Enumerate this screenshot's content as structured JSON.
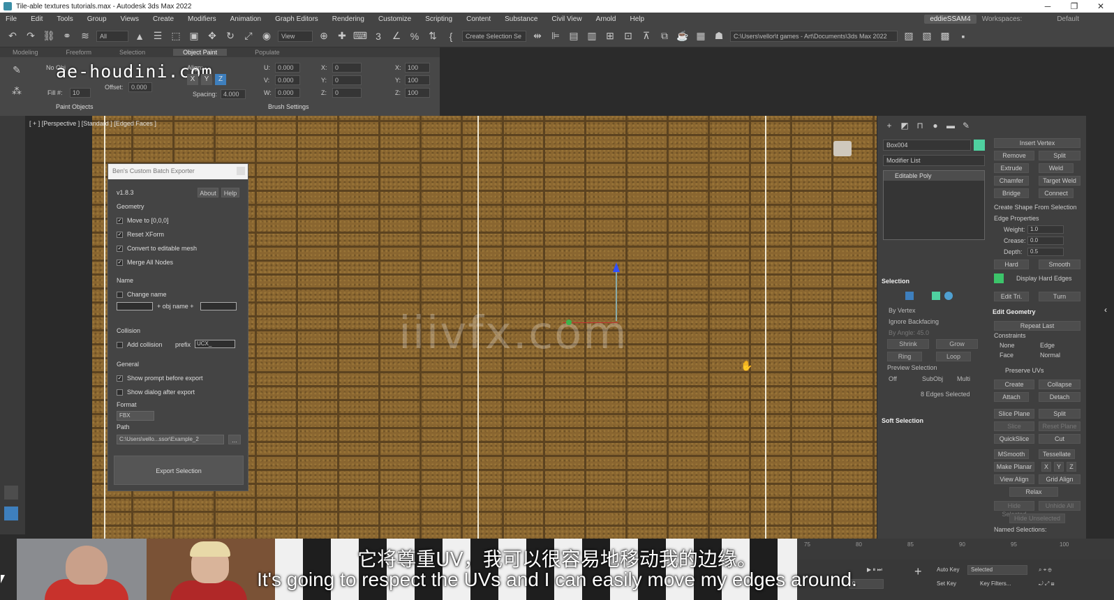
{
  "window": {
    "title": "Tile-able textures tutorials.max - Autodesk 3ds Max 2022",
    "controls": [
      "─",
      "❐",
      "✕"
    ]
  },
  "menubar": {
    "items": [
      "File",
      "Edit",
      "Tools",
      "Group",
      "Views",
      "Create",
      "Modifiers",
      "Animation",
      "Graph Editors",
      "Rendering",
      "Customize",
      "Scripting",
      "Content",
      "Substance",
      "Civil View",
      "Arnold",
      "Help"
    ],
    "user": "eddieSSAM4",
    "workspaces_label": "Workspaces:",
    "workspaces_value": "Default"
  },
  "toolbar": {
    "filter": "All",
    "view": "View",
    "selection_set": "Create Selection Se",
    "path": "C:\\Users\\vellor\\t games - Art\\Documents\\3ds Max 2022",
    "icons": [
      "undo-icon",
      "redo-icon",
      "link-icon",
      "unlink-icon",
      "bind-icon",
      "select-icon",
      "select-by-name-icon",
      "rect-select-icon",
      "window-crossing-icon",
      "move-icon",
      "rotate-icon",
      "scale-icon",
      "placement-icon"
    ]
  },
  "ribbon": {
    "tabs": [
      "Modeling",
      "Freeform",
      "Selection",
      "Object Paint",
      "Populate"
    ],
    "active_tab": "Object Paint",
    "no_object": "No Obj",
    "align_label": "Align:",
    "fill_label": "Fill #:",
    "fill_value": "10",
    "offset_label": "Offset:",
    "offset_value": "0.000",
    "spacing_label": "Spacing:",
    "spacing_value": "4.000",
    "u_value": "0.000",
    "v_value": "0.000",
    "w_value": "0.000",
    "x_value": "0",
    "y_value": "0",
    "z_value": "0",
    "scale_x": "100",
    "scale_y": "100",
    "scale_z": "100",
    "axes": [
      "X",
      "Y",
      "Z"
    ],
    "paint_objects": "Paint Objects",
    "brush_settings": "Brush Settings",
    "logo_watermark": "ae-houdini.com"
  },
  "viewport": {
    "label": "[ + ] [Perspective ] [Standard ] [Edged Faces ]",
    "watermark": "iiivfx.com"
  },
  "exporter": {
    "title": "Ben's Custom Batch Exporter",
    "version": "v1.8.3",
    "about": "About",
    "help": "Help",
    "geometry_label": "Geometry",
    "geometry_options": [
      {
        "label": "Move to [0,0,0]",
        "checked": true
      },
      {
        "label": "Reset XForm",
        "checked": true
      },
      {
        "label": "Convert to editable mesh",
        "checked": true
      },
      {
        "label": "Merge All Nodes",
        "checked": true
      }
    ],
    "name_label": "Name",
    "change_name": "Change name",
    "obj_name_text": "+ obj name +",
    "collision_label": "Collision",
    "add_collision": "Add collision",
    "prefix_label": "prefix",
    "prefix_value": "UCX_",
    "general_label": "General",
    "show_prompt": "Show prompt before export",
    "show_dialog": "Show dialog after export",
    "format_label": "Format",
    "format_value": "FBX",
    "path_label": "Path",
    "path_value": "C:\\Users\\vello...ssor\\Example_2",
    "browse": "...",
    "export_button": "Export Selection"
  },
  "command_panel": {
    "object_name": "Box004",
    "object_color": "#4fd1a0",
    "modifier_list": "Modifier List",
    "stack_item": "Editable Poly",
    "selection_head": "Selection",
    "by_vertex": "By Vertex",
    "ignore_backfacing": "Ignore Backfacing",
    "by_angle": "By Angle: 45.0",
    "shrink": "Shrink",
    "grow": "Grow",
    "ring": "Ring",
    "loop": "Loop",
    "preview_selection": "Preview Selection",
    "preview_off": "Off",
    "preview_subobj": "SubObj",
    "preview_multi": "Multi",
    "edges_selected": "8 Edges Selected",
    "soft_selection": "Soft Selection"
  },
  "edit_panel": {
    "insert_vertex": "Insert Vertex",
    "remove": "Remove",
    "split": "Split",
    "extrude": "Extrude",
    "weld": "Weld",
    "chamfer": "Chamfer",
    "target_weld": "Target Weld",
    "bridge": "Bridge",
    "connect": "Connect",
    "create_shape": "Create Shape From Selection",
    "edge_properties": "Edge Properties",
    "weight_label": "Weight:",
    "weight_value": "1.0",
    "crease_label": "Crease:",
    "crease_value": "0.0",
    "depth_label": "Depth:",
    "depth_value": "0.5",
    "hard": "Hard",
    "smooth": "Smooth",
    "display_hard_edges": "Display Hard Edges",
    "edit_tri": "Edit Tri.",
    "turn": "Turn",
    "edit_geometry": "Edit Geometry",
    "repeat_last": "Repeat Last",
    "constraints": "Constraints",
    "c_none": "None",
    "c_edge": "Edge",
    "c_face": "Face",
    "c_normal": "Normal",
    "preserve_uvs": "Preserve UVs",
    "create": "Create",
    "collapse": "Collapse",
    "attach": "Attach",
    "detach": "Detach",
    "slice_plane": "Slice Plane",
    "split2": "Split",
    "slice": "Slice",
    "reset_plane": "Reset Plane",
    "quickslice": "QuickSlice",
    "cut": "Cut",
    "msmooth": "MSmooth",
    "tessellate": "Tessellate",
    "make_planar": "Make Planar",
    "x": "X",
    "y": "Y",
    "z": "Z",
    "view_align": "View Align",
    "grid_align": "Grid Align",
    "relax": "Relax",
    "hide_selected": "Hide Selected",
    "unhide_all": "Unhide All",
    "hide_unselected": "Hide Unselected",
    "named_selections": "Named Selections:"
  },
  "timeline": {
    "ticks": [
      "75",
      "80",
      "85",
      "90",
      "95",
      "100"
    ]
  },
  "bottom": {
    "auto_key": "Auto Key",
    "selected": "Selected",
    "set_key": "Set Key",
    "key_filters": "Key Filters...",
    "frame_value": "0"
  },
  "subtitles": {
    "zh": "它将尊重UV，我可以很容易地移动我的边缘。",
    "en": "It's going to respect the UVs and I can easily move my edges around."
  }
}
